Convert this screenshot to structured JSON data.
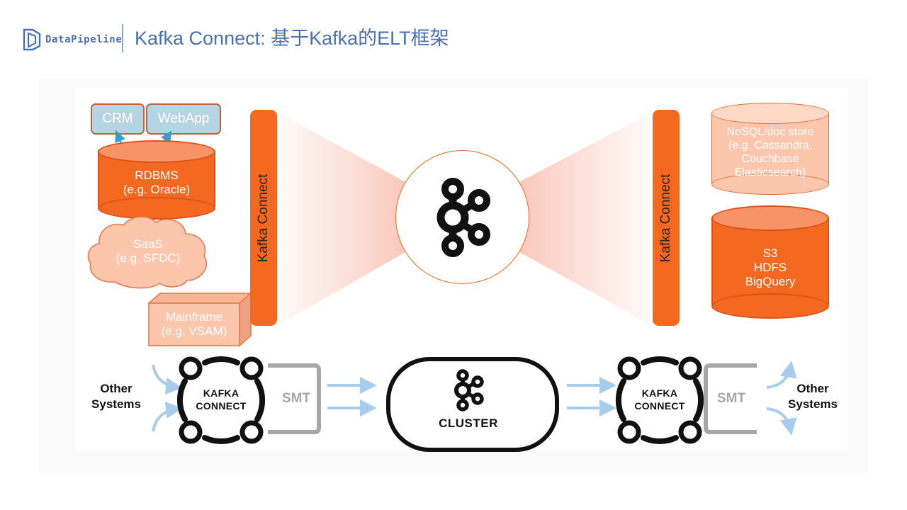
{
  "header": {
    "logo_text": "DataPipeline",
    "logo_icon": "datapipeline-cube-logo",
    "title": "Kafka Connect: 基于Kafka的ELT框架",
    "title_color": "#4a6fb5"
  },
  "diagram": {
    "sources": {
      "apps": [
        {
          "label": "CRM",
          "shape": "rounded-box",
          "fill": "#b6d5e3",
          "border": "#c0643f"
        },
        {
          "label": "WebApp",
          "shape": "rounded-box",
          "fill": "#b6d5e3",
          "border": "#c0643f"
        }
      ],
      "rdbms": {
        "line1": "RDBMS",
        "line2": "(e.g. Oracle)",
        "shape": "cylinder",
        "fill": "#f4681f"
      },
      "saas": {
        "line1": "SaaS",
        "line2": "(e.g. SFDC)",
        "shape": "cloud",
        "fill": "#fbc6ac"
      },
      "mainframe": {
        "line1": "Mainframe",
        "line2": "(e.g. VSAM)",
        "shape": "3d-box",
        "fill": "#fbc6ac"
      }
    },
    "connect_bar_left": {
      "label": "Kafka Connect",
      "fill": "#f4681f"
    },
    "connect_bar_right": {
      "label": "Kafka Connect",
      "fill": "#f4681f"
    },
    "center": {
      "icon": "kafka-logo",
      "circle_border": "#f4681f"
    },
    "funnel_color": "#f9bfaf",
    "targets": {
      "nosql": {
        "line1": "NoSQL/doc store",
        "line2": "(e.g. Cassandra,",
        "line3": "Couchbase",
        "line4": "Elasticsearch)",
        "shape": "cylinder",
        "fill": "#fbc6ac"
      },
      "objectstore": {
        "line1": "S3",
        "line2": "HDFS",
        "line3": "BigQuery",
        "shape": "cylinder",
        "fill": "#f4681f"
      }
    },
    "flow": {
      "left_other_systems": {
        "line1": "Other",
        "line2": "Systems"
      },
      "right_other_systems": {
        "line1": "Other",
        "line2": "Systems"
      },
      "left_connect": {
        "line1": "KAFKA",
        "line2": "CONNECT"
      },
      "right_connect": {
        "line1": "KAFKA",
        "line2": "CONNECT"
      },
      "left_smt": "SMT",
      "right_smt": "SMT",
      "cluster": {
        "label": "CLUSTER",
        "icon": "kafka-logo"
      },
      "arrow_color": "#a8cdec",
      "bracket_color": "#a6a6a6"
    }
  }
}
